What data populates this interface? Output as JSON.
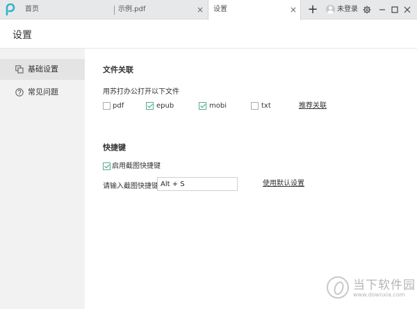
{
  "tabs": [
    {
      "label": "首页"
    },
    {
      "label": "示例.pdf"
    },
    {
      "label": "设置"
    }
  ],
  "titlebar": {
    "login_label": "未登录",
    "close_glyph": "×",
    "new_tab_glyph": "+"
  },
  "page": {
    "title": "设置"
  },
  "sidebar": {
    "items": [
      {
        "label": "基础设置",
        "icon": "copy-icon",
        "active": true
      },
      {
        "label": "常见问题",
        "icon": "question-icon",
        "active": false
      }
    ]
  },
  "file_assoc": {
    "title": "文件关联",
    "subtitle": "用苏打办公打开以下文件",
    "options": [
      {
        "label": "pdf",
        "checked": false
      },
      {
        "label": "epub",
        "checked": true
      },
      {
        "label": "mobi",
        "checked": true
      },
      {
        "label": "txt",
        "checked": false
      }
    ],
    "recommend_link": "推荐关联"
  },
  "shortcut": {
    "title": "快捷键",
    "enable_label": "启用截图快捷键",
    "enable_checked": true,
    "input_label": "请输入截图快捷键",
    "input_value": "Alt + S",
    "default_link": "使用默认设置"
  },
  "watermark": {
    "title": "当下软件园",
    "url": "www.downxia.com"
  },
  "colors": {
    "check": "#3aa07a",
    "logo": "#2fb3c6"
  }
}
